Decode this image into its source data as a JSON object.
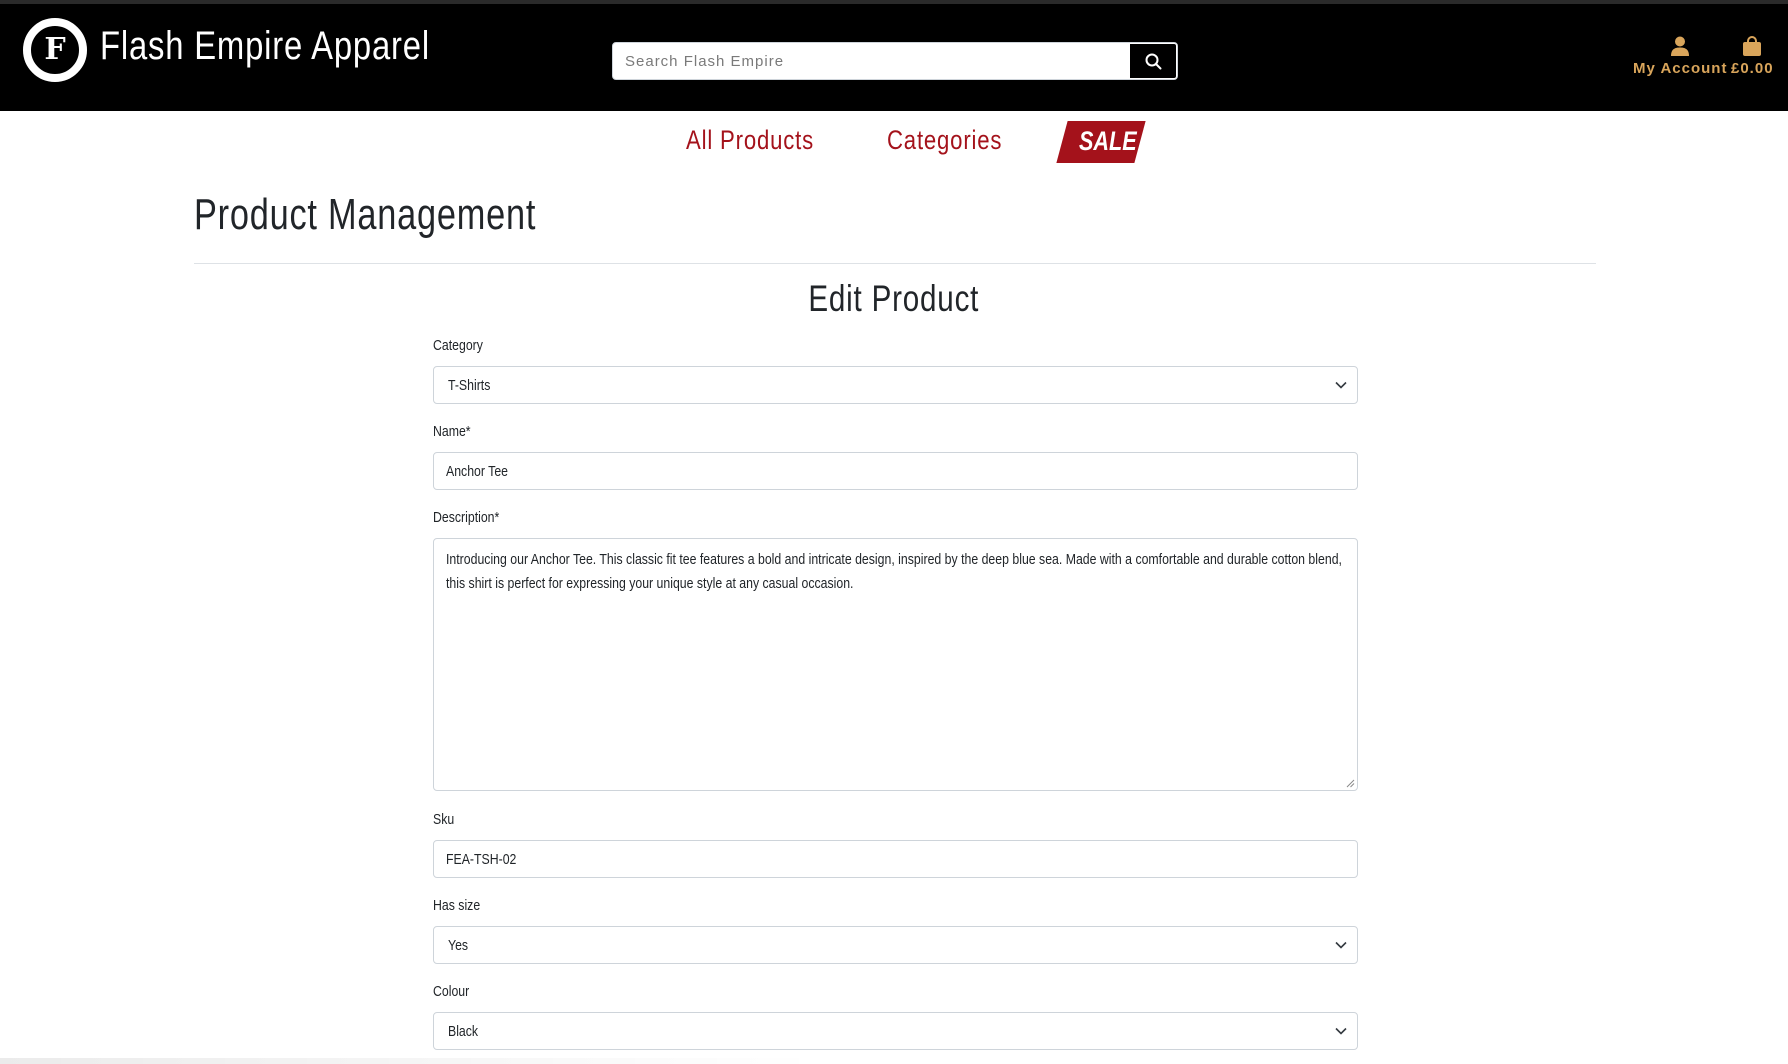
{
  "header": {
    "logo_letter": "F",
    "brand": "Flash Empire Apparel",
    "search_placeholder": "Search Flash Empire",
    "account_label": "My Account",
    "bag_total": "£0.00",
    "icons": [
      "logo-icon",
      "search-icon",
      "user-icon",
      "shopping-bag-icon"
    ]
  },
  "nav": {
    "all_products": "All Products",
    "categories": "Categories",
    "sale": "SALE"
  },
  "page": {
    "title": "Product Management",
    "form_title": "Edit Product"
  },
  "form": {
    "category": {
      "label": "Category",
      "value": "T-Shirts"
    },
    "name": {
      "label": "Name*",
      "value": "Anchor Tee"
    },
    "description": {
      "label": "Description*",
      "value": "Introducing our Anchor Tee. This classic fit tee features a bold and intricate design, inspired by the deep blue sea. Made with a comfortable and durable cotton blend, this shirt is perfect for expressing your unique style at any casual occasion."
    },
    "sku": {
      "label": "Sku",
      "value": "FEA-TSH-02"
    },
    "has_size": {
      "label": "Has size",
      "value": "Yes"
    },
    "colour": {
      "label": "Colour",
      "value": "Black"
    }
  },
  "colors": {
    "header_bg": "#000000",
    "accent_gold": "#d9a55b",
    "nav_red": "#a4121b"
  }
}
